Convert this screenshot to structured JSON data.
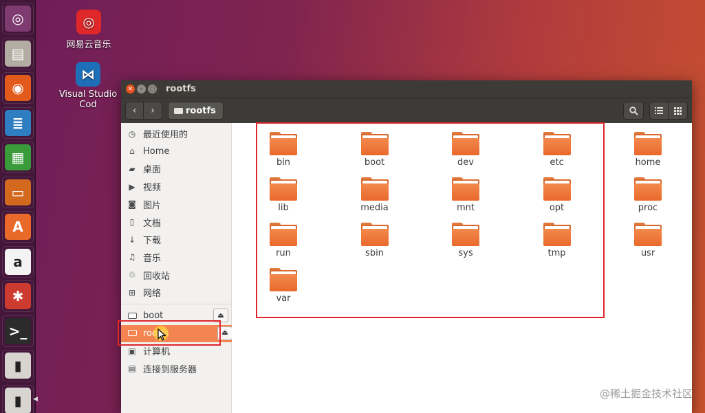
{
  "launcher": {
    "items": [
      {
        "name": "dash-icon",
        "bg": "#7e3b70"
      },
      {
        "name": "files-icon",
        "bg": "#b3aca2"
      },
      {
        "name": "firefox-icon",
        "bg": "#e25a1c"
      },
      {
        "name": "writer-icon",
        "bg": "#2f7ec2"
      },
      {
        "name": "calc-icon",
        "bg": "#3a9b3b"
      },
      {
        "name": "impress-icon",
        "bg": "#d2691e"
      },
      {
        "name": "software-icon",
        "bg": "#e8692a"
      },
      {
        "name": "amazon-icon",
        "bg": "#f3f3f3"
      },
      {
        "name": "settings-icon",
        "bg": "#cc3b2f"
      },
      {
        "name": "terminal-icon",
        "bg": "#2b2b2b"
      },
      {
        "name": "usb-drive-icon",
        "bg": "#d8d5d0"
      },
      {
        "name": "usb-drive-icon",
        "bg": "#d8d5d0"
      }
    ]
  },
  "desktop": {
    "icons": [
      {
        "label": "网易云音乐",
        "icon": "netease-music-icon",
        "color": "#e0282a"
      },
      {
        "label": "Visual Studio Cod",
        "icon": "vscode-icon",
        "color": "#1f6fb8"
      }
    ]
  },
  "window": {
    "title": "rootfs",
    "path_button": "rootfs",
    "buttons": {
      "back": "‹",
      "forward": "›",
      "search": "⚲",
      "list": "☰",
      "grid": "⋮⋮"
    }
  },
  "sidebar": {
    "places": [
      {
        "label": "最近使用的",
        "icon": "clock-icon",
        "glyph": "◷"
      },
      {
        "label": "Home",
        "icon": "home-icon",
        "glyph": "⌂"
      },
      {
        "label": "桌面",
        "icon": "desktop-folder-icon",
        "glyph": "▰"
      },
      {
        "label": "视频",
        "icon": "video-icon",
        "glyph": "▶"
      },
      {
        "label": "图片",
        "icon": "camera-icon",
        "glyph": "◙"
      },
      {
        "label": "文档",
        "icon": "document-icon",
        "glyph": "▯"
      },
      {
        "label": "下载",
        "icon": "download-icon",
        "glyph": "↓"
      },
      {
        "label": "音乐",
        "icon": "music-icon",
        "glyph": "♫"
      },
      {
        "label": "回收站",
        "icon": "trash-icon",
        "glyph": "♲"
      },
      {
        "label": "网络",
        "icon": "network-icon",
        "glyph": "⊞"
      }
    ],
    "devices": [
      {
        "label": "boot",
        "active": false
      },
      {
        "label": "rootfs",
        "active": true
      }
    ],
    "other": [
      {
        "label": "计算机",
        "icon": "computer-icon",
        "glyph": "▣"
      },
      {
        "label": "连接到服务器",
        "icon": "server-icon",
        "glyph": "▤"
      }
    ],
    "eject_glyph": "⏏"
  },
  "folders": [
    "bin",
    "boot",
    "dev",
    "etc",
    "home",
    "lib",
    "media",
    "mnt",
    "opt",
    "proc",
    "run",
    "sbin",
    "sys",
    "tmp",
    "usr",
    "var"
  ],
  "watermark": "@稀土掘金技术社区",
  "colors": {
    "accent": "#e95420",
    "selection": "#f48552",
    "highlight_box": "#e0252a"
  }
}
